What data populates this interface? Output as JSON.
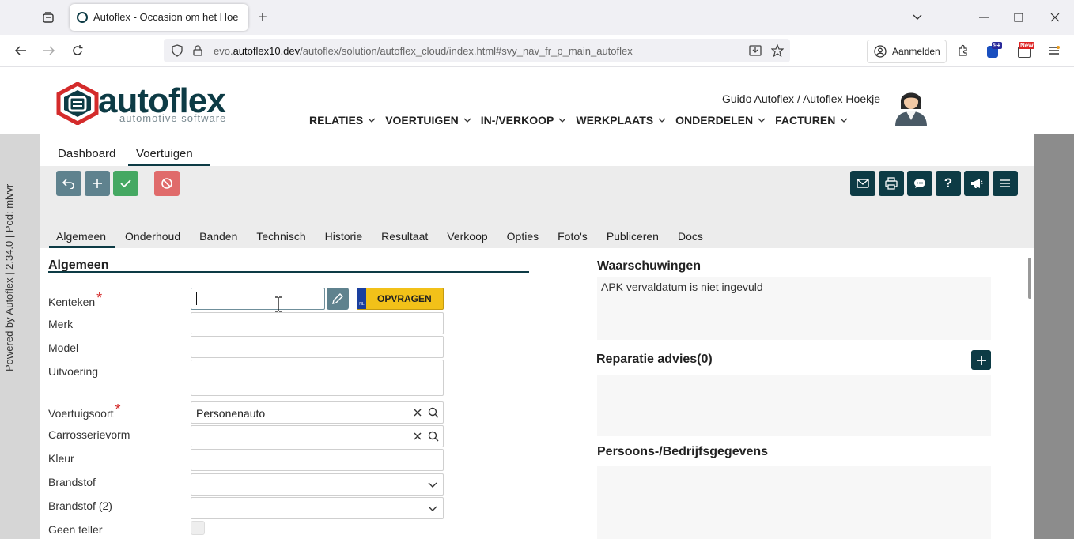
{
  "browser": {
    "tab_title": "Autoflex - Occasion om het Hoe",
    "url_prefix": "evo.",
    "url_domain": "autoflex10.dev",
    "url_path": "/autoflex/solution/autoflex_cloud/index.html#svy_nav_fr_p_main_autoflex",
    "signin_label": "Aanmelden",
    "ext_badge_1": "9+",
    "ext_badge_2": "New"
  },
  "app": {
    "logo_main": "autoflex",
    "logo_sub": "automotive software",
    "user_link": "Guido Autoflex / Autoflex Hoekje",
    "menu": [
      "RELATIES",
      "VOERTUIGEN",
      "IN-/VERKOOP",
      "WERKPLAATS",
      "ONDERDELEN",
      "FACTUREN"
    ],
    "subtabs": [
      "Dashboard",
      "Voertuigen"
    ],
    "sidebar_text": "Powered by Autoflex | 2.34.0 | Pod: mlvvr",
    "tabs": [
      "Algemeen",
      "Onderhoud",
      "Banden",
      "Technisch",
      "Historie",
      "Resultaat",
      "Verkoop",
      "Opties",
      "Foto's",
      "Publiceren",
      "Docs"
    ],
    "colors": {
      "accent": "#0d3b45",
      "grey_btn": "#5f828e",
      "green_btn": "#45a862",
      "red_btn": "#e06b6b",
      "yellow": "#f2c119",
      "logo_red": "#d42b2b"
    }
  },
  "form": {
    "section_title": "Algemeen",
    "fields": {
      "kenteken": "Kenteken",
      "merk": "Merk",
      "model": "Model",
      "uitvoering": "Uitvoering",
      "voertuigsoort": "Voertuigsoort",
      "voertuigsoort_value": "Personenauto",
      "carrosserievorm": "Carrosserievorm",
      "kleur": "Kleur",
      "brandstof": "Brandstof",
      "brandstof2": "Brandstof (2)",
      "geen_teller": "Geen teller"
    },
    "required_mark": "*",
    "opvragen_label": "OPVRAGEN",
    "nl_label": "NL"
  },
  "right": {
    "warnings_title": "Waarschuwingen",
    "warning_text": "APK vervaldatum is niet ingevuld",
    "repair_title": "Reparatie advies(0)",
    "persons_title": "Persoons-/Bedrijfsgegevens"
  }
}
